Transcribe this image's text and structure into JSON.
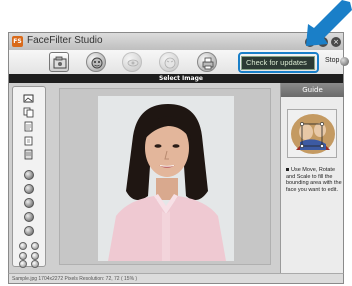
{
  "app": {
    "title": "FaceFilter Studio",
    "logo_text": "FS"
  },
  "window_buttons": {
    "help": "?",
    "minimize": "-",
    "close": "×"
  },
  "toolbar": {
    "items": [
      {
        "name": "select-image",
        "icon": "image-folder-icon",
        "active": true
      },
      {
        "name": "color-correction",
        "icon": "face-palette-icon",
        "active": false
      },
      {
        "name": "red-eye",
        "icon": "eye-icon",
        "active": false
      },
      {
        "name": "wrinkle",
        "icon": "face-smooth-icon",
        "active": false
      },
      {
        "name": "print",
        "icon": "printer-icon",
        "active": false
      }
    ],
    "check_updates_label": "Check for updates",
    "stop_label": "Stop",
    "stop_icon": "stop-circle-icon"
  },
  "section": {
    "title": "Select Image"
  },
  "left_tools": {
    "top_icons": [
      "open-image-icon",
      "copy-icon",
      "paste-icon",
      "rotate-icon",
      "list-icon"
    ],
    "circle_buttons": [
      "tool-circle-1",
      "tool-circle-2",
      "tool-circle-3",
      "tool-circle-4",
      "tool-circle-5"
    ],
    "bottom_icons": [
      "zoom-fit-icon",
      "zoom-reset-icon",
      "zoom-in-icon",
      "zoom-out-icon",
      "prev-icon",
      "next-icon"
    ]
  },
  "guide": {
    "header": "Guide",
    "text": "Use Move, Rotate and Scale to fill the bounding area with the face you want to edit."
  },
  "status": {
    "text": "Sample.jpg 1704x2272 Pixels Resolution: 72, 72 ( 15% )"
  },
  "colors": {
    "accent": "#1a7fc8",
    "section_bar": "#1e1e1e",
    "check_updates_bg": "#2c3a34",
    "guide_header": "#7a7a7a"
  }
}
